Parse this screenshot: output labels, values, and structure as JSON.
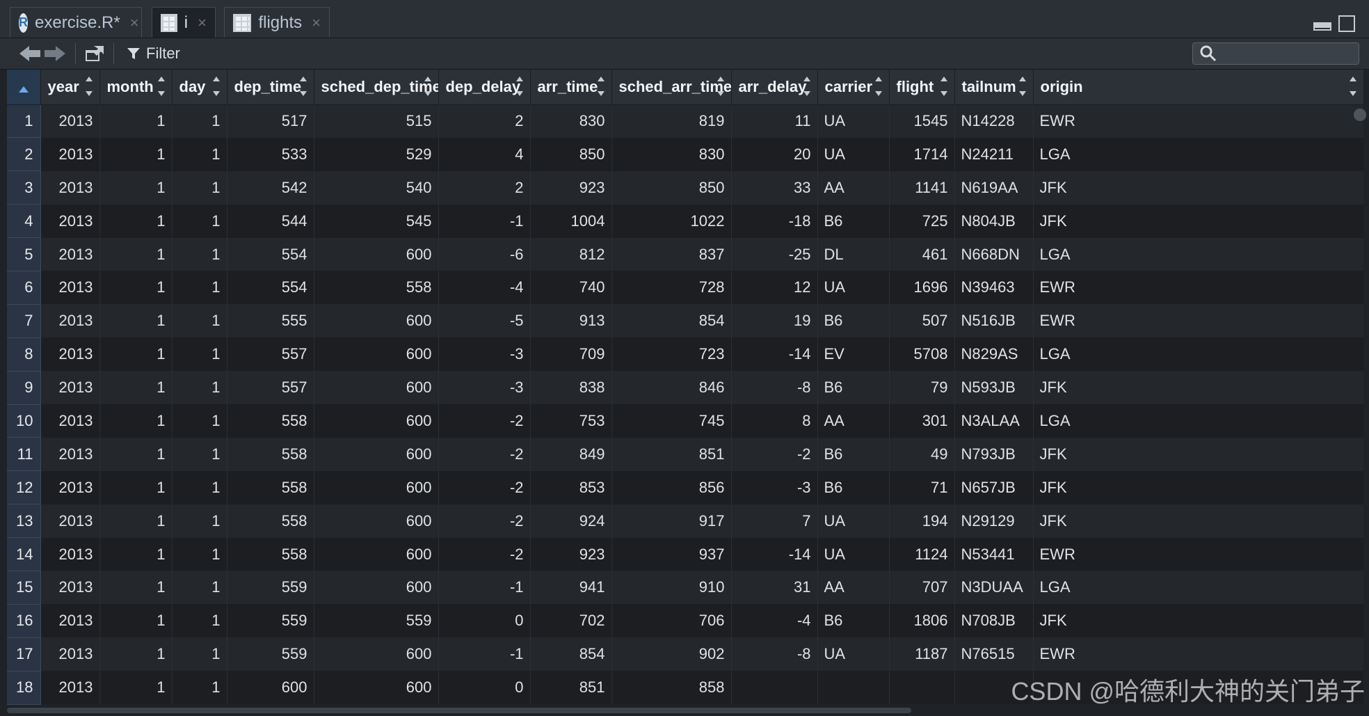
{
  "tabs": [
    {
      "label": "exercise.R*",
      "icon": "r-file-icon"
    },
    {
      "label": "i",
      "icon": "grid-icon"
    },
    {
      "label": "flights",
      "icon": "grid-icon"
    }
  ],
  "toolbar": {
    "filter_label": "Filter",
    "search_placeholder": ""
  },
  "table": {
    "columns": [
      "year",
      "month",
      "day",
      "dep_time",
      "sched_dep_time",
      "dep_delay",
      "arr_time",
      "sched_arr_time",
      "arr_delay",
      "carrier",
      "flight",
      "tailnum",
      "origin"
    ],
    "rows": [
      [
        "2013",
        "1",
        "1",
        "517",
        "515",
        "2",
        "830",
        "819",
        "11",
        "UA",
        "1545",
        "N14228",
        "EWR"
      ],
      [
        "2013",
        "1",
        "1",
        "533",
        "529",
        "4",
        "850",
        "830",
        "20",
        "UA",
        "1714",
        "N24211",
        "LGA"
      ],
      [
        "2013",
        "1",
        "1",
        "542",
        "540",
        "2",
        "923",
        "850",
        "33",
        "AA",
        "1141",
        "N619AA",
        "JFK"
      ],
      [
        "2013",
        "1",
        "1",
        "544",
        "545",
        "-1",
        "1004",
        "1022",
        "-18",
        "B6",
        "725",
        "N804JB",
        "JFK"
      ],
      [
        "2013",
        "1",
        "1",
        "554",
        "600",
        "-6",
        "812",
        "837",
        "-25",
        "DL",
        "461",
        "N668DN",
        "LGA"
      ],
      [
        "2013",
        "1",
        "1",
        "554",
        "558",
        "-4",
        "740",
        "728",
        "12",
        "UA",
        "1696",
        "N39463",
        "EWR"
      ],
      [
        "2013",
        "1",
        "1",
        "555",
        "600",
        "-5",
        "913",
        "854",
        "19",
        "B6",
        "507",
        "N516JB",
        "EWR"
      ],
      [
        "2013",
        "1",
        "1",
        "557",
        "600",
        "-3",
        "709",
        "723",
        "-14",
        "EV",
        "5708",
        "N829AS",
        "LGA"
      ],
      [
        "2013",
        "1",
        "1",
        "557",
        "600",
        "-3",
        "838",
        "846",
        "-8",
        "B6",
        "79",
        "N593JB",
        "JFK"
      ],
      [
        "2013",
        "1",
        "1",
        "558",
        "600",
        "-2",
        "753",
        "745",
        "8",
        "AA",
        "301",
        "N3ALAA",
        "LGA"
      ],
      [
        "2013",
        "1",
        "1",
        "558",
        "600",
        "-2",
        "849",
        "851",
        "-2",
        "B6",
        "49",
        "N793JB",
        "JFK"
      ],
      [
        "2013",
        "1",
        "1",
        "558",
        "600",
        "-2",
        "853",
        "856",
        "-3",
        "B6",
        "71",
        "N657JB",
        "JFK"
      ],
      [
        "2013",
        "1",
        "1",
        "558",
        "600",
        "-2",
        "924",
        "917",
        "7",
        "UA",
        "194",
        "N29129",
        "JFK"
      ],
      [
        "2013",
        "1",
        "1",
        "558",
        "600",
        "-2",
        "923",
        "937",
        "-14",
        "UA",
        "1124",
        "N53441",
        "EWR"
      ],
      [
        "2013",
        "1",
        "1",
        "559",
        "600",
        "-1",
        "941",
        "910",
        "31",
        "AA",
        "707",
        "N3DUAA",
        "LGA"
      ],
      [
        "2013",
        "1",
        "1",
        "559",
        "559",
        "0",
        "702",
        "706",
        "-4",
        "B6",
        "1806",
        "N708JB",
        "JFK"
      ],
      [
        "2013",
        "1",
        "1",
        "559",
        "600",
        "-1",
        "854",
        "902",
        "-8",
        "UA",
        "1187",
        "N76515",
        "EWR"
      ],
      [
        "2013",
        "1",
        "1",
        "600",
        "600",
        "0",
        "851",
        "858",
        "",
        "",
        "",
        "",
        ""
      ]
    ]
  },
  "watermark": "CSDN @哈德利大神的关门弟子"
}
